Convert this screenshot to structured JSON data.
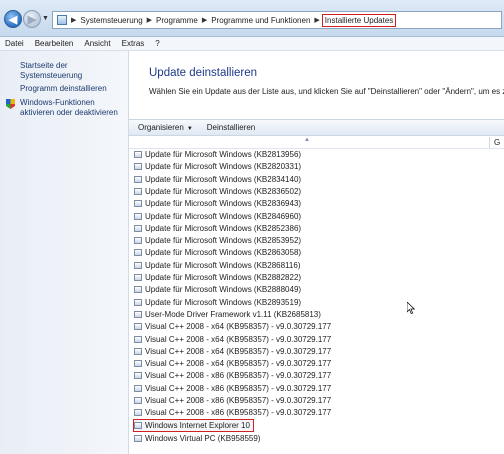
{
  "address_bar": {
    "breadcrumbs": [
      "Systemsteuerung",
      "Programme",
      "Programme und Funktionen",
      "Installierte Updates"
    ],
    "highlight_color": "#d21f1f"
  },
  "menu": [
    "Datei",
    "Bearbeiten",
    "Ansicht",
    "Extras",
    "?"
  ],
  "sidebar": {
    "home_link": "Startseite der Systemsteuerung",
    "uninstall_link": "Programm deinstallieren",
    "features_link_line1": "Windows-Funktionen",
    "features_link_line2": "aktivieren oder deaktivieren"
  },
  "main": {
    "title": "Update deinstallieren",
    "description": "Wählen Sie ein Update aus der Liste aus, und klicken Sie auf \"Deinstallieren\" oder \"Ändern\", um es zu de",
    "toolbar": {
      "organize": "Organisieren",
      "uninstall": "Deinstallieren"
    },
    "column_partial": "G"
  },
  "updates": [
    "Update für Microsoft Windows (KB2813956)",
    "Update für Microsoft Windows (KB2820331)",
    "Update für Microsoft Windows (KB2834140)",
    "Update für Microsoft Windows (KB2836502)",
    "Update für Microsoft Windows (KB2836943)",
    "Update für Microsoft Windows (KB2846960)",
    "Update für Microsoft Windows (KB2852386)",
    "Update für Microsoft Windows (KB2853952)",
    "Update für Microsoft Windows (KB2863058)",
    "Update für Microsoft Windows (KB2868116)",
    "Update für Microsoft Windows (KB2882822)",
    "Update für Microsoft Windows (KB2888049)",
    "Update für Microsoft Windows (KB2893519)",
    "User-Mode Driver Framework v1.11 (KB2685813)",
    "Visual C++ 2008 - x64 (KB958357) - v9.0.30729.177",
    "Visual C++ 2008 - x64 (KB958357) - v9.0.30729.177",
    "Visual C++ 2008 - x64 (KB958357) - v9.0.30729.177",
    "Visual C++ 2008 - x64 (KB958357) - v9.0.30729.177",
    "Visual C++ 2008 - x86 (KB958357) - v9.0.30729.177",
    "Visual C++ 2008 - x86 (KB958357) - v9.0.30729.177",
    "Visual C++ 2008 - x86 (KB958357) - v9.0.30729.177",
    "Visual C++ 2008 - x86 (KB958357) - v9.0.30729.177",
    "Windows Internet Explorer 10",
    "Windows Virtual PC (KB958559)"
  ]
}
